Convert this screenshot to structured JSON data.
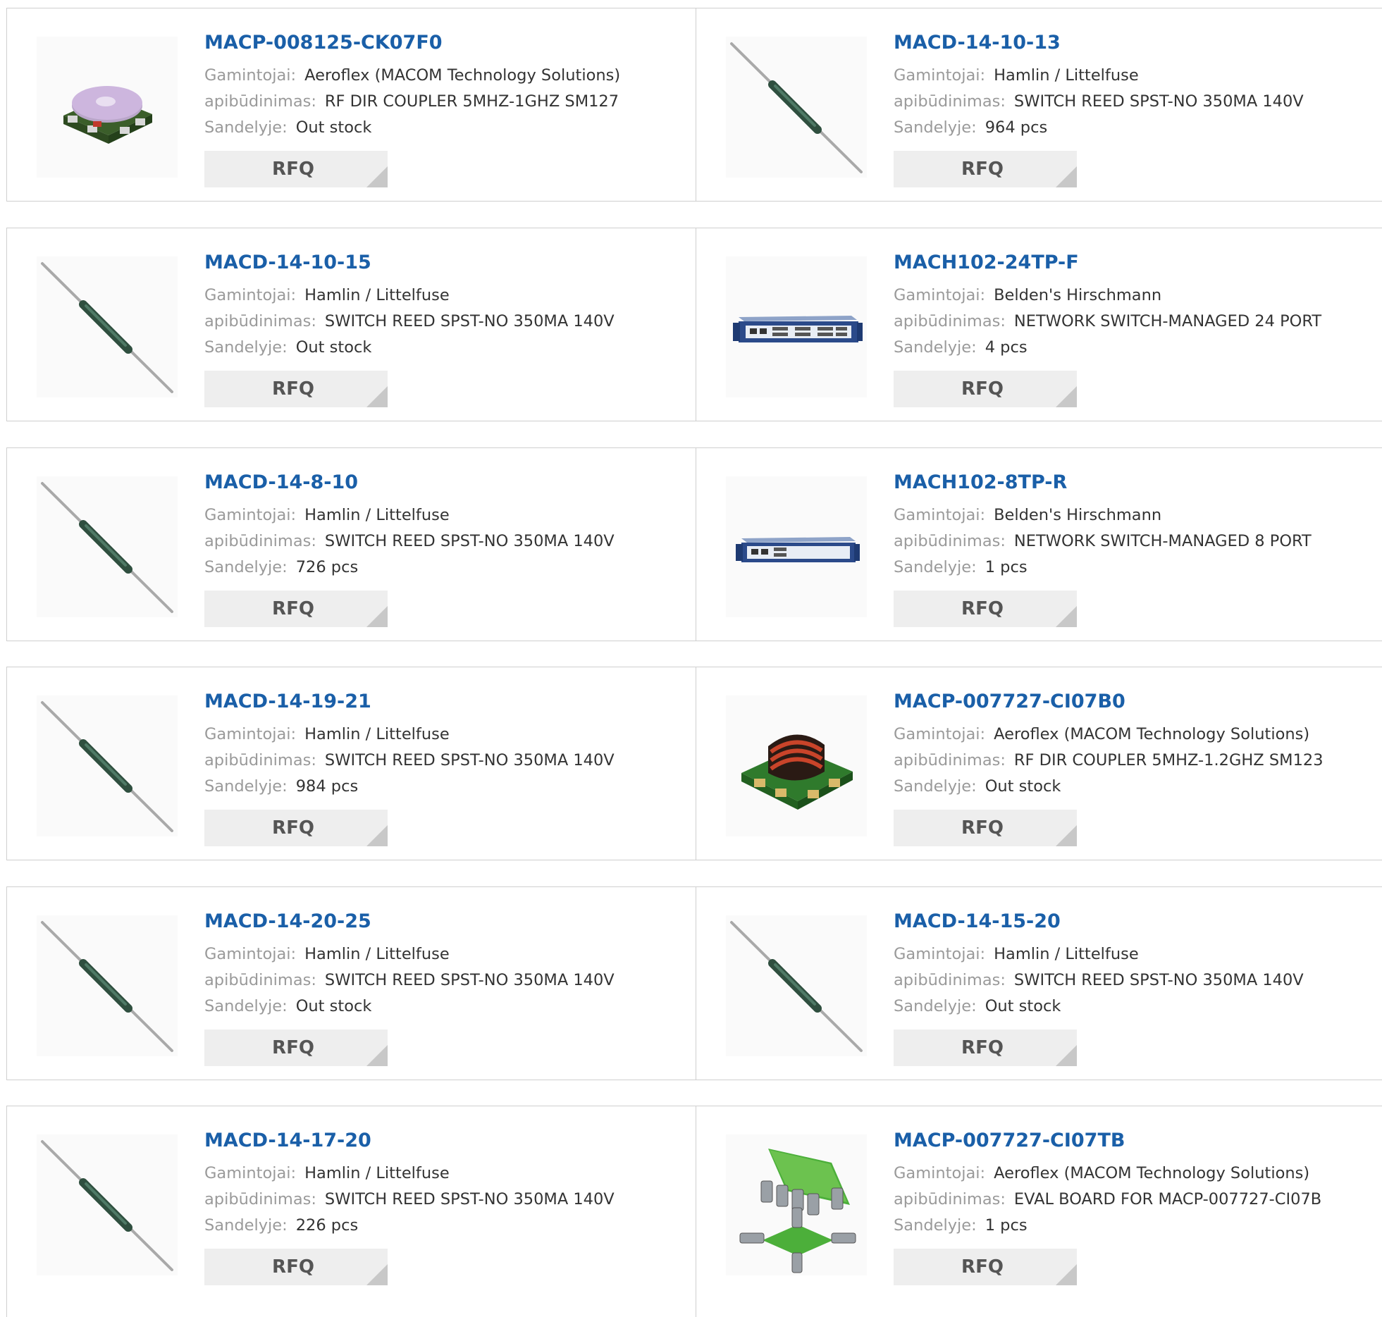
{
  "labels": {
    "manufacturer": "Gamintojai:",
    "description": "apibūdinimas:",
    "stock": "Sandelyje:",
    "rfq": "RFQ"
  },
  "products": [
    {
      "part": "MACP-008125-CK07F0",
      "manufacturer": "Aeroflex (MACOM Technology Solutions)",
      "description": "RF DIR COUPLER 5MHZ-1GHZ SM127",
      "stock": "Out stock",
      "image": "coupler-image"
    },
    {
      "part": "MACD-14-10-13",
      "manufacturer": "Hamlin / Littelfuse",
      "description": "SWITCH REED SPST-NO 350MA 140V",
      "stock": "964 pcs",
      "image": "reed-switch-image"
    },
    {
      "part": "MACD-14-10-15",
      "manufacturer": "Hamlin / Littelfuse",
      "description": "SWITCH REED SPST-NO 350MA 140V",
      "stock": "Out stock",
      "image": "reed-switch-image"
    },
    {
      "part": "MACH102-24TP-F",
      "manufacturer": "Belden's Hirschmann",
      "description": "NETWORK SWITCH-MANAGED 24 PORT",
      "stock": "4 pcs",
      "image": "network-switch-image"
    },
    {
      "part": "MACD-14-8-10",
      "manufacturer": "Hamlin / Littelfuse",
      "description": "SWITCH REED SPST-NO 350MA 140V",
      "stock": "726 pcs",
      "image": "reed-switch-image"
    },
    {
      "part": "MACH102-8TP-R",
      "manufacturer": "Belden's Hirschmann",
      "description": "NETWORK SWITCH-MANAGED 8 PORT",
      "stock": "1 pcs",
      "image": "network-switch-image"
    },
    {
      "part": "MACD-14-19-21",
      "manufacturer": "Hamlin / Littelfuse",
      "description": "SWITCH REED SPST-NO 350MA 140V",
      "stock": "984 pcs",
      "image": "reed-switch-image"
    },
    {
      "part": "MACP-007727-CI07B0",
      "manufacturer": "Aeroflex (MACOM Technology Solutions)",
      "description": "RF DIR COUPLER 5MHZ-1.2GHZ SM123",
      "stock": "Out stock",
      "image": "transformer-image"
    },
    {
      "part": "MACD-14-20-25",
      "manufacturer": "Hamlin / Littelfuse",
      "description": "SWITCH REED SPST-NO 350MA 140V",
      "stock": "Out stock",
      "image": "reed-switch-image"
    },
    {
      "part": "MACD-14-15-20",
      "manufacturer": "Hamlin / Littelfuse",
      "description": "SWITCH REED SPST-NO 350MA 140V",
      "stock": "Out stock",
      "image": "reed-switch-image"
    },
    {
      "part": "MACD-14-17-20",
      "manufacturer": "Hamlin / Littelfuse",
      "description": "SWITCH REED SPST-NO 350MA 140V",
      "stock": "226 pcs",
      "image": "reed-switch-image"
    },
    {
      "part": "MACP-007727-CI07TB",
      "manufacturer": "Aeroflex (MACOM Technology Solutions)",
      "description": "EVAL BOARD FOR MACP-007727-CI07B",
      "stock": "1 pcs",
      "image": "eval-board-image"
    }
  ],
  "colors": {
    "part_link": "#1a5fa8",
    "label": "#9a9a9a",
    "value": "#333333",
    "border": "#cfcfcf",
    "rfq_bg": "#eeeeee"
  }
}
